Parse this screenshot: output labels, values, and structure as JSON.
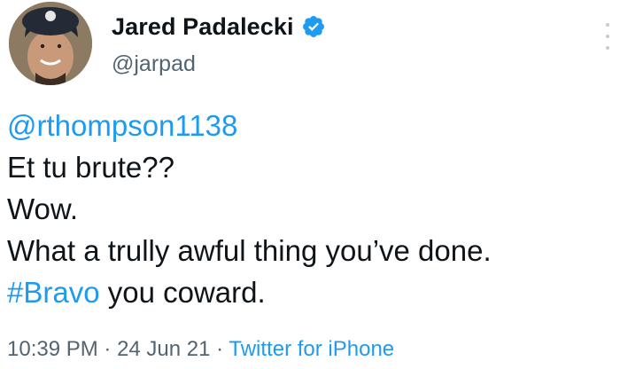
{
  "user": {
    "display_name": "Jared Padalecki",
    "handle": "@jarpad",
    "verified_icon": "verified-badge-icon",
    "avatar_icon": "avatar"
  },
  "tweet": {
    "mention": "@rthompson1138",
    "line1": "Et tu brute??",
    "line2": "Wow.",
    "line3": "What a trully awful thing you’ve done.",
    "hashtag": "#Bravo",
    "line4_rest": " you coward."
  },
  "meta": {
    "time": "10:39 PM",
    "sep1": " · ",
    "date": "24 Jun 21",
    "sep2": " · ",
    "source": "Twitter for iPhone"
  },
  "colors": {
    "link": "#1d9bf0",
    "secondary_text": "#536471",
    "primary_text": "#0f1419"
  }
}
